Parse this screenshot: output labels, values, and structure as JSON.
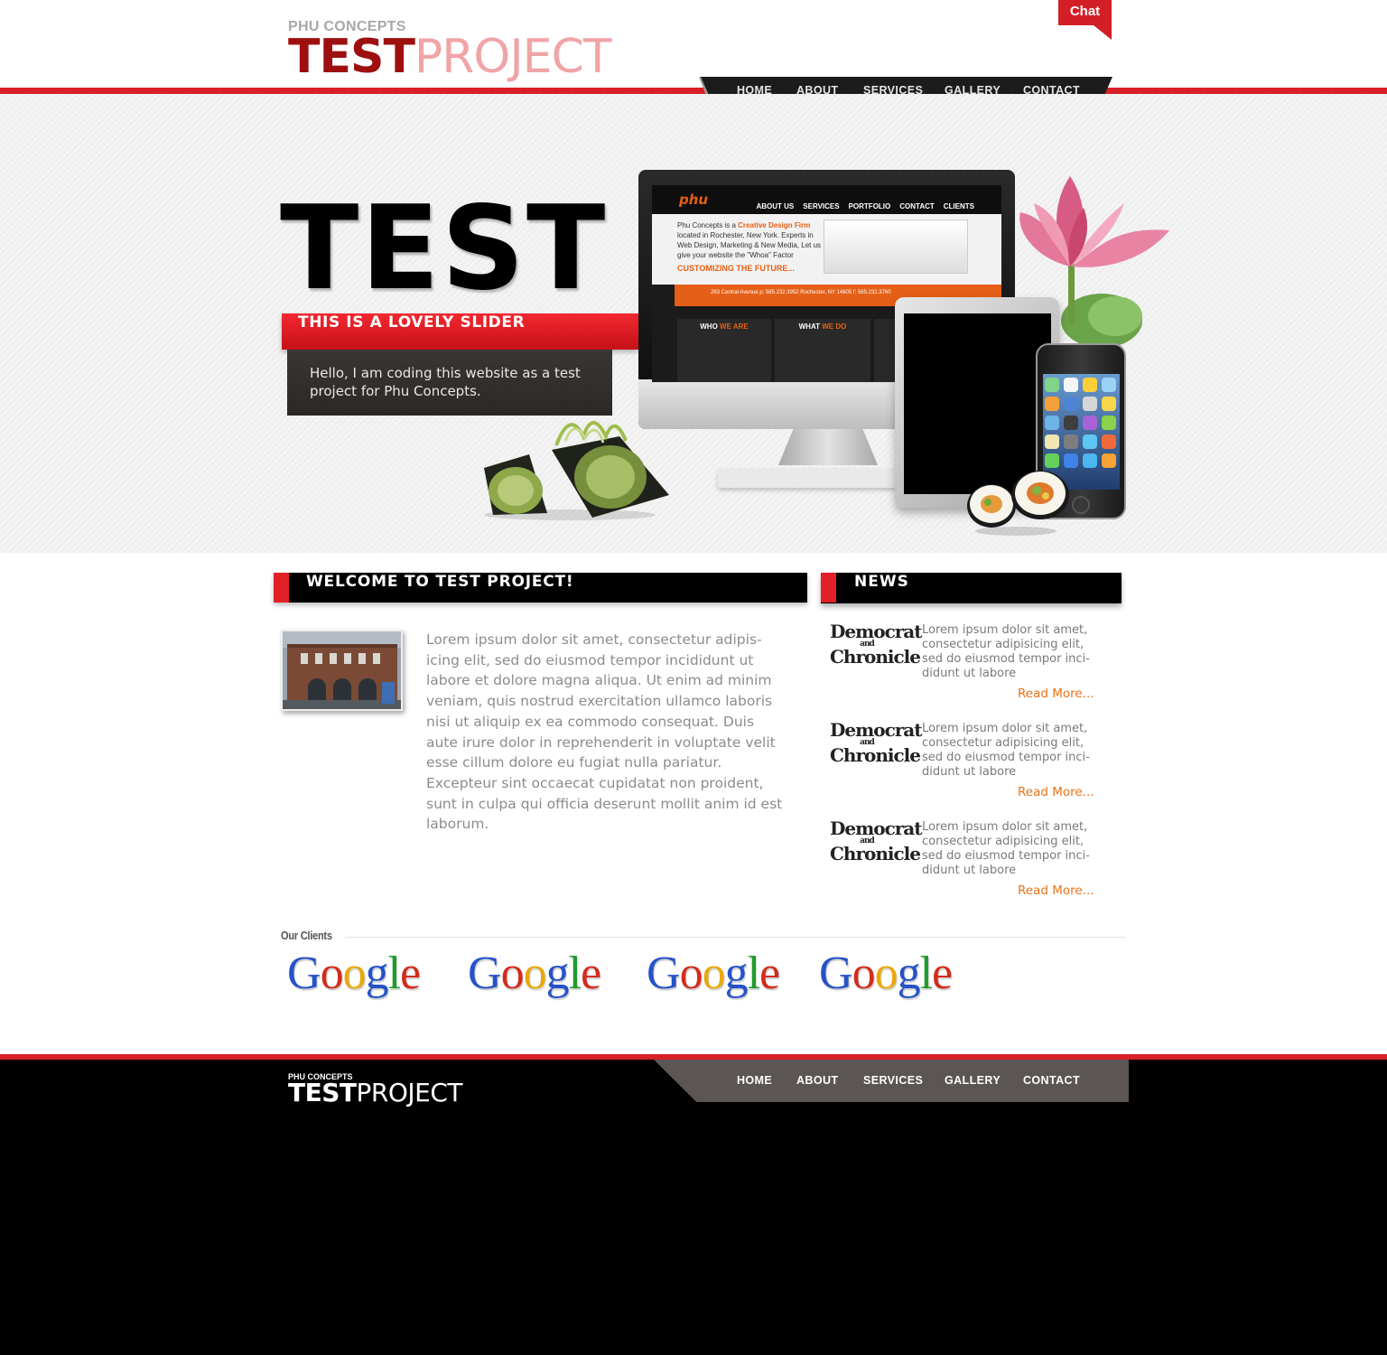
{
  "header": {
    "logo_sub": "PHU CONCEPTS",
    "logo_main_bold": "TEST",
    "logo_main_light": "PROJECT",
    "chat_label": "Chat",
    "nav": [
      "HOME",
      "ABOUT",
      "SERVICES",
      "GALLERY",
      "CONTACT"
    ]
  },
  "hero": {
    "title": "TEST",
    "slider_title": "THIS IS A LOVELY SLIDER",
    "slider_text": "Hello, I am coding this website as a test project for Phu Concepts.",
    "screen": {
      "logo": "phu",
      "nav": [
        "ABOUT US",
        "SERVICES",
        "PORTFOLIO",
        "CONTACT",
        "CLIENTS"
      ],
      "intro_prefix": "Phu Concepts is a ",
      "intro_bold": "Creative Design Firm",
      "intro_rest": " located in Rochester, New York. Experts in Web Design, Marketing & New Media, Let us give your website the \"Whoa\" Factor",
      "cta": "CUSTOMIZING THE FUTURE...",
      "address": "263 Central Avenue   p: 585.232.3952   Rochester, NY 14605   f: 585.232.3760",
      "col1_a": "WHO ",
      "col1_b": "WE ARE",
      "col2_a": "WHAT ",
      "col2_b": "WE DO"
    }
  },
  "welcome": {
    "heading": "WELCOME TO TEST PROJECT!",
    "body": "Lorem ipsum dolor sit amet, consectetur adipis-icing elit, sed do eiusmod tempor incididunt ut labore et dolore magna aliqua. Ut enim ad minim veniam, quis nostrud exercitation ullamco laboris nisi ut aliquip ex ea commodo consequat. Duis aute irure dolor in reprehenderit in voluptate velit esse cillum dolore eu fugiat nulla pariatur. Excepteur sint occaecat cupidatat non proident, sunt in culpa qui officia deserunt mollit anim id est laborum."
  },
  "news": {
    "heading": "NEWS",
    "items": [
      {
        "logo_top": "Democrat",
        "logo_mid": "and",
        "logo_bot": "Chronicle",
        "text": "Lorem ipsum dolor sit amet, consectetur adipisicing elit, sed do eiusmod tempor inci-didunt ut labore",
        "more": "Read More..."
      },
      {
        "logo_top": "Democrat",
        "logo_mid": "and",
        "logo_bot": "Chronicle",
        "text": "Lorem ipsum dolor sit amet, consectetur adipisicing elit, sed do eiusmod tempor inci-didunt ut labore",
        "more": "Read More..."
      },
      {
        "logo_top": "Democrat",
        "logo_mid": "and",
        "logo_bot": "Chronicle",
        "text": "Lorem ipsum dolor sit amet, consectetur adipisicing elit, sed do eiusmod tempor inci-didunt ut labore",
        "more": "Read More..."
      }
    ]
  },
  "clients": {
    "label": "Our Clients",
    "logos": [
      "Google",
      "Google",
      "Google",
      "Google"
    ]
  },
  "footer": {
    "logo_sub": "PHU CONCEPTS",
    "logo_main_bold": "TEST",
    "logo_main_light": "PROJECT",
    "nav": [
      "HOME",
      "ABOUT",
      "SERVICES",
      "GALLERY",
      "CONTACT"
    ]
  },
  "colors": {
    "accent_red": "#d92027",
    "logo_dark_red": "#9e0f10",
    "logo_pink": "#f0a4a7",
    "link_orange": "#e8731a",
    "nav_dark": "#1c1c1c",
    "footer_nav": "#5b5653"
  }
}
